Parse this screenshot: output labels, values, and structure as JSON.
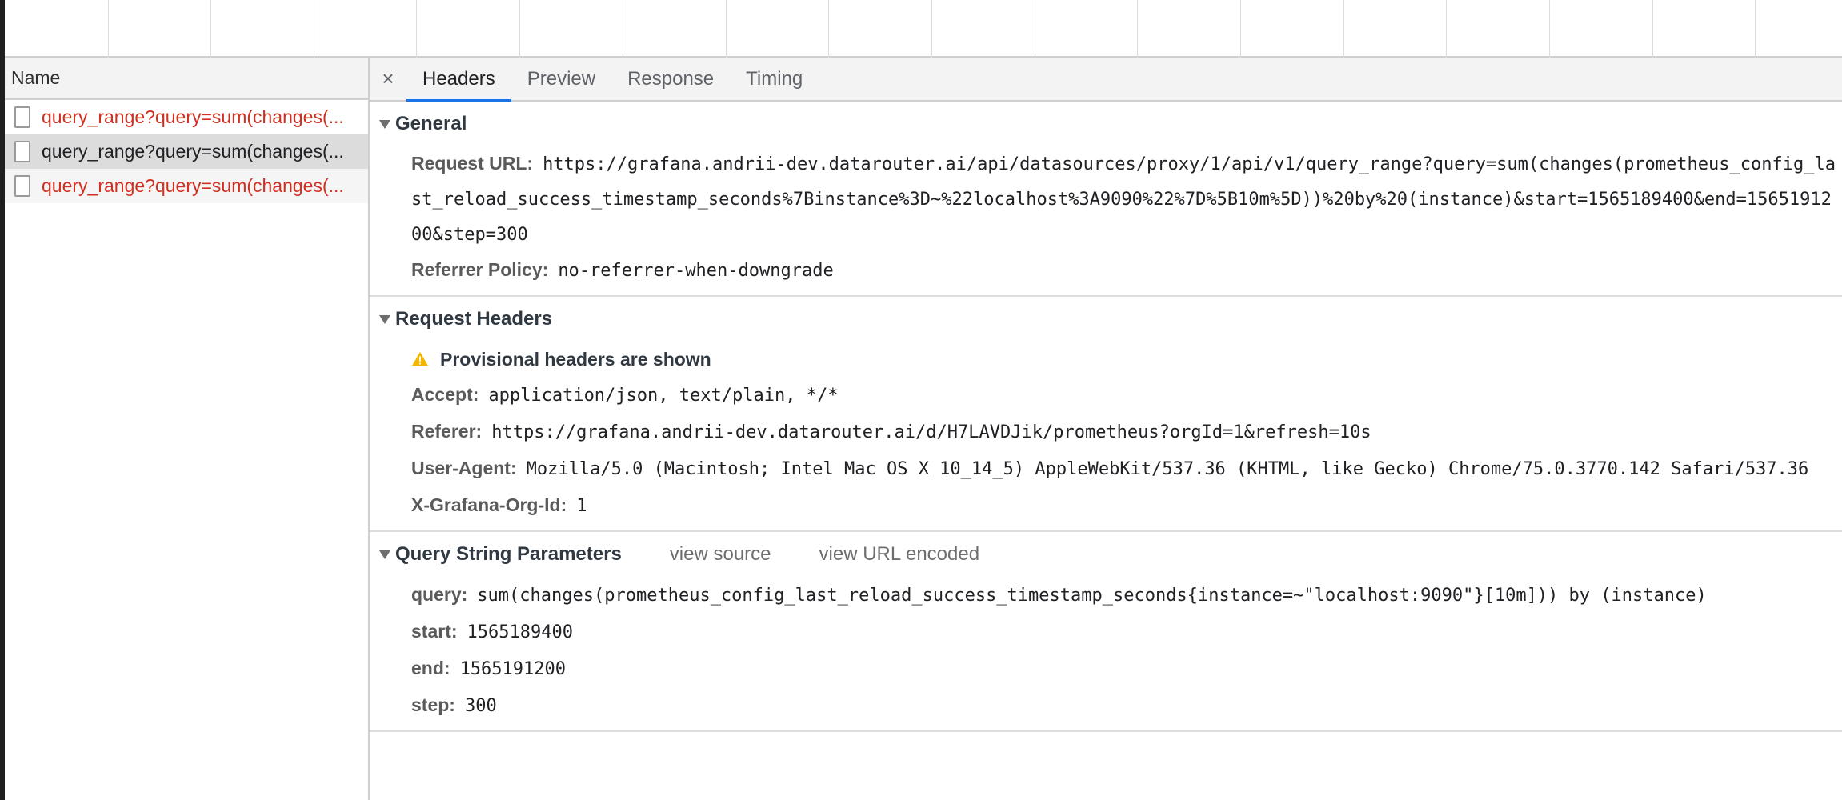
{
  "list": {
    "header": "Name",
    "requests": [
      {
        "name": "query_range?query=sum(changes(...",
        "status": "error"
      },
      {
        "name": "query_range?query=sum(changes(...",
        "status": "selected"
      },
      {
        "name": "query_range?query=sum(changes(...",
        "status": "error"
      }
    ]
  },
  "tabs": {
    "close": "×",
    "items": [
      "Headers",
      "Preview",
      "Response",
      "Timing"
    ],
    "active": "Headers"
  },
  "general": {
    "title": "General",
    "request_url_label": "Request URL:",
    "request_url": "https://grafana.andrii-dev.datarouter.ai/api/datasources/proxy/1/api/v1/query_range?query=sum(changes(prometheus_config_last_reload_success_timestamp_seconds%7Binstance%3D~%22localhost%3A9090%22%7D%5B10m%5D))%20by%20(instance)&start=1565189400&end=1565191200&step=300",
    "referrer_policy_label": "Referrer Policy:",
    "referrer_policy": "no-referrer-when-downgrade"
  },
  "request_headers": {
    "title": "Request Headers",
    "warning": "Provisional headers are shown",
    "accept_label": "Accept:",
    "accept": "application/json, text/plain, */*",
    "referer_label": "Referer:",
    "referer": "https://grafana.andrii-dev.datarouter.ai/d/H7LAVDJik/prometheus?orgId=1&refresh=10s",
    "user_agent_label": "User-Agent:",
    "user_agent": "Mozilla/5.0 (Macintosh; Intel Mac OS X 10_14_5) AppleWebKit/537.36 (KHTML, like Gecko) Chrome/75.0.3770.142 Safari/537.36",
    "org_id_label": "X-Grafana-Org-Id:",
    "org_id": "1"
  },
  "query_params": {
    "title": "Query String Parameters",
    "view_source": "view source",
    "view_url_encoded": "view URL encoded",
    "query_label": "query:",
    "query": "sum(changes(prometheus_config_last_reload_success_timestamp_seconds{instance=~\"localhost:9090\"}[10m])) by (instance)",
    "start_label": "start:",
    "start": "1565189400",
    "end_label": "end:",
    "end": "1565191200",
    "step_label": "step:",
    "step": "300"
  },
  "colors": {
    "error_text": "#d32f20",
    "active_tab_underline": "#1a73e8",
    "warning_icon": "#f2b600"
  },
  "icons": {
    "file": "file-icon",
    "close": "close-icon",
    "collapse": "triangle-down-icon",
    "warning": "warning-icon"
  }
}
